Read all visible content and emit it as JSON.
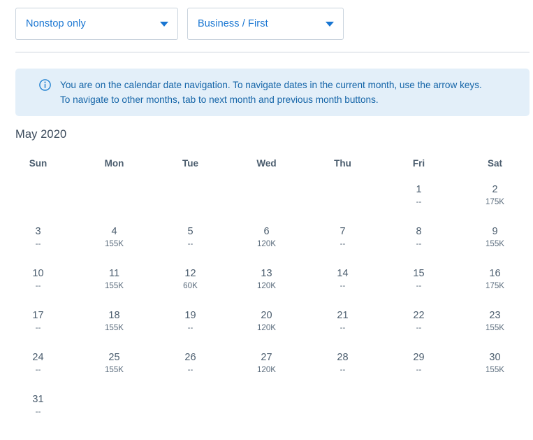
{
  "filters": [
    {
      "name": "stops-filter",
      "value": "Nonstop only",
      "icon": "chevron-down-icon"
    },
    {
      "name": "cabin-filter",
      "value": "Business / First",
      "icon": "chevron-down-icon"
    }
  ],
  "banner": {
    "icon": "info-icon",
    "text": "You are on the calendar date navigation. To navigate dates in the current month, use the arrow keys. To navigate to other months, tab to next month and previous month buttons.",
    "background": "#e3eff9",
    "text_color": "#1565a8"
  },
  "calendar": {
    "month_title": "May 2020",
    "weekdays": [
      "Sun",
      "Mon",
      "Tue",
      "Wed",
      "Thu",
      "Fri",
      "Sat"
    ],
    "weeks": [
      [
        {
          "day": "",
          "price": ""
        },
        {
          "day": "",
          "price": ""
        },
        {
          "day": "",
          "price": ""
        },
        {
          "day": "",
          "price": ""
        },
        {
          "day": "",
          "price": ""
        },
        {
          "day": "1",
          "price": "--"
        },
        {
          "day": "2",
          "price": "175K"
        }
      ],
      [
        {
          "day": "3",
          "price": "--"
        },
        {
          "day": "4",
          "price": "155K"
        },
        {
          "day": "5",
          "price": "--"
        },
        {
          "day": "6",
          "price": "120K"
        },
        {
          "day": "7",
          "price": "--"
        },
        {
          "day": "8",
          "price": "--"
        },
        {
          "day": "9",
          "price": "155K"
        }
      ],
      [
        {
          "day": "10",
          "price": "--"
        },
        {
          "day": "11",
          "price": "155K"
        },
        {
          "day": "12",
          "price": "60K"
        },
        {
          "day": "13",
          "price": "120K"
        },
        {
          "day": "14",
          "price": "--"
        },
        {
          "day": "15",
          "price": "--"
        },
        {
          "day": "16",
          "price": "175K"
        }
      ],
      [
        {
          "day": "17",
          "price": "--"
        },
        {
          "day": "18",
          "price": "155K"
        },
        {
          "day": "19",
          "price": "--"
        },
        {
          "day": "20",
          "price": "120K"
        },
        {
          "day": "21",
          "price": "--"
        },
        {
          "day": "22",
          "price": "--"
        },
        {
          "day": "23",
          "price": "155K"
        }
      ],
      [
        {
          "day": "24",
          "price": "--"
        },
        {
          "day": "25",
          "price": "155K"
        },
        {
          "day": "26",
          "price": "--"
        },
        {
          "day": "27",
          "price": "120K"
        },
        {
          "day": "28",
          "price": "--"
        },
        {
          "day": "29",
          "price": "--"
        },
        {
          "day": "30",
          "price": "155K"
        }
      ],
      [
        {
          "day": "31",
          "price": "--"
        },
        {
          "day": "",
          "price": ""
        },
        {
          "day": "",
          "price": ""
        },
        {
          "day": "",
          "price": ""
        },
        {
          "day": "",
          "price": ""
        },
        {
          "day": "",
          "price": ""
        },
        {
          "day": "",
          "price": ""
        }
      ]
    ]
  },
  "colors": {
    "accent": "#1976d2",
    "text": "#4b5d6e",
    "banner_bg": "#e3eff9",
    "border": "#c9d3dd"
  }
}
